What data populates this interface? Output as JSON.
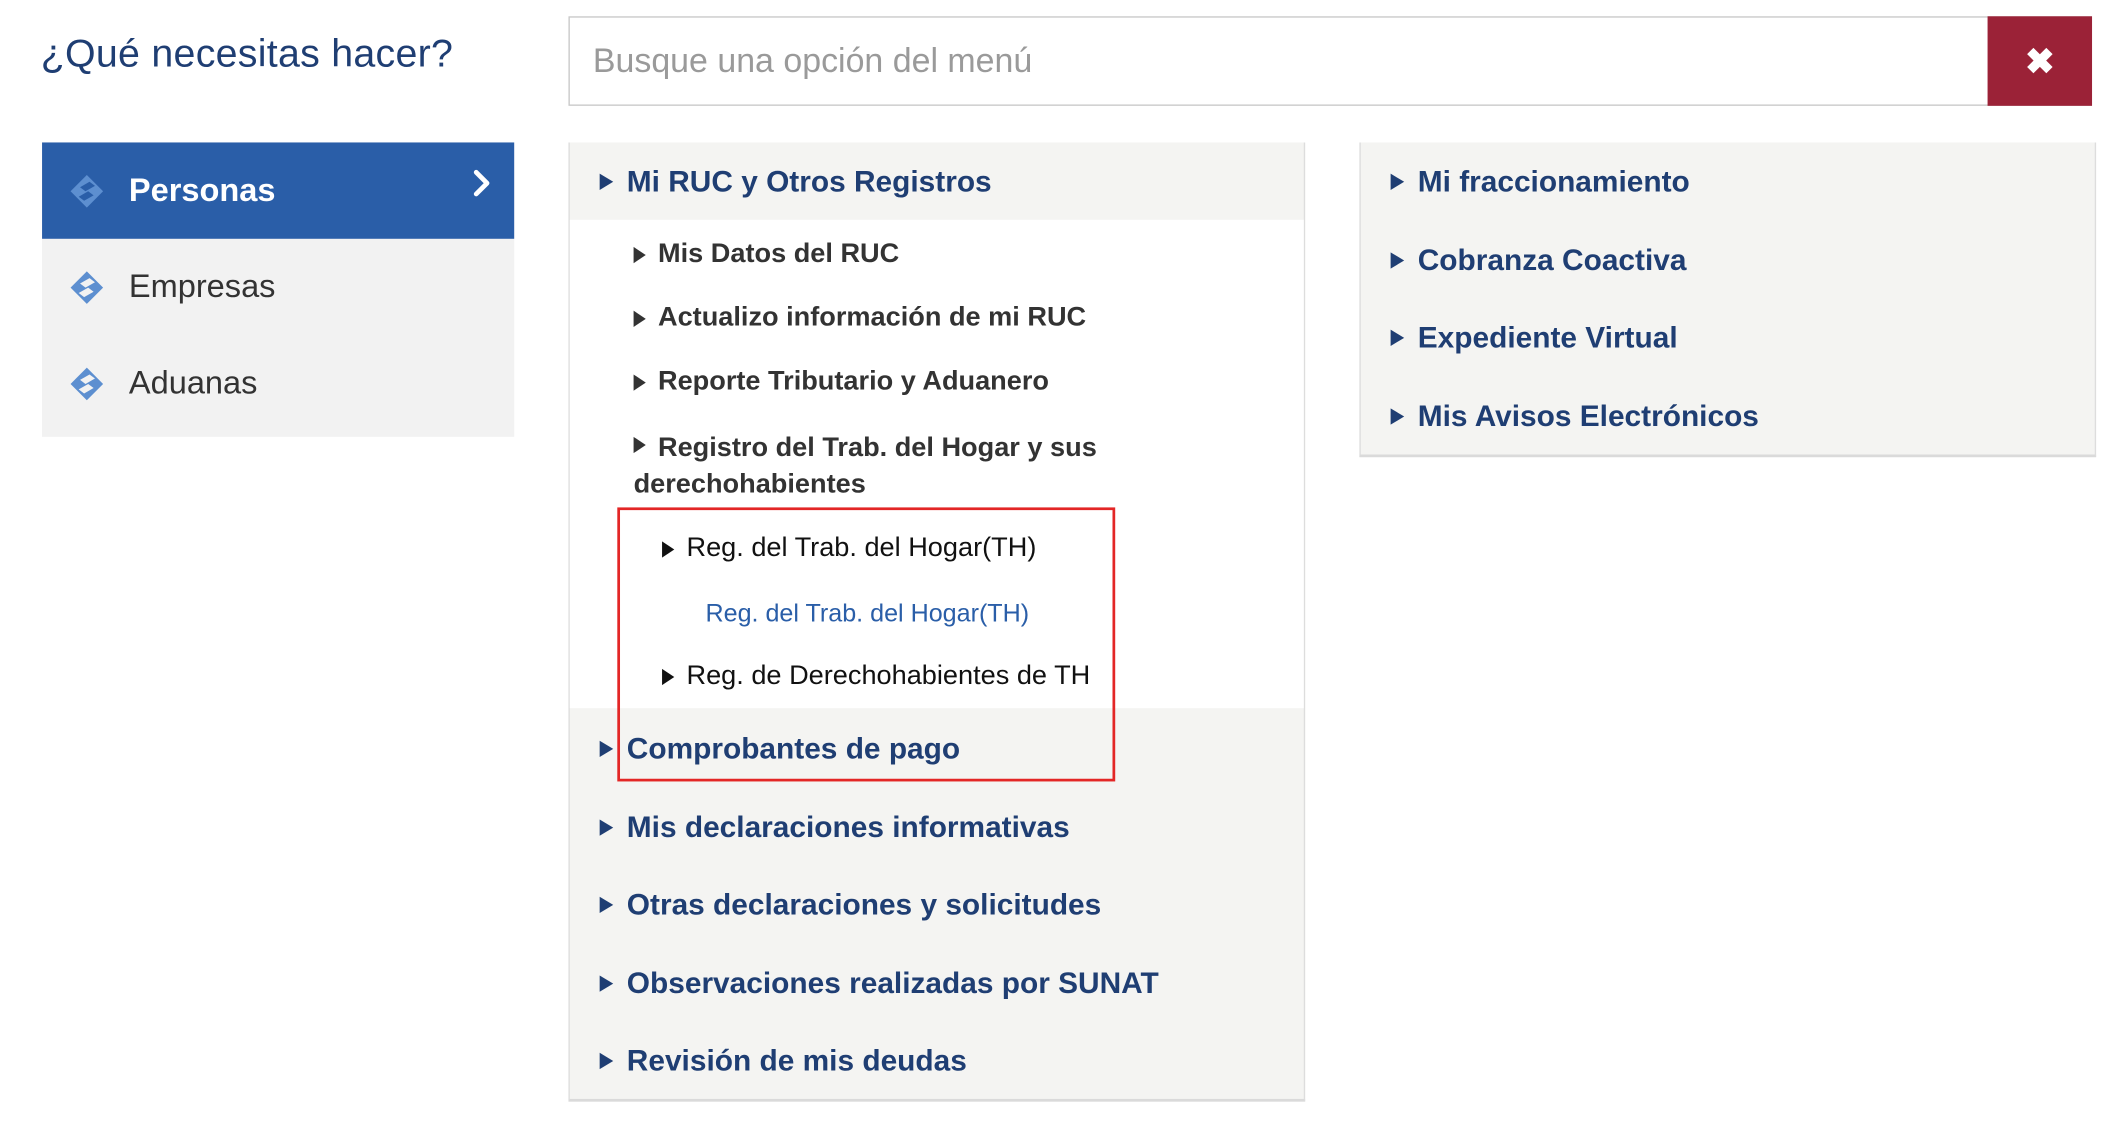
{
  "heading": "¿Qué necesitas hacer?",
  "search": {
    "placeholder": "Busque una opción del menú",
    "value": "",
    "clear_label": "✖"
  },
  "colors": {
    "primary_blue": "#1f3e73",
    "active_blue": "#2a5ea8",
    "clear_red": "#9b2237",
    "highlight_red": "#e32626",
    "panel_bg": "#f4f4f2"
  },
  "sidebar": {
    "items": [
      {
        "label": "Personas",
        "icon": "sunat-logo-icon",
        "active": true
      },
      {
        "label": "Empresas",
        "icon": "sunat-logo-icon",
        "active": false
      },
      {
        "label": "Aduanas",
        "icon": "sunat-logo-icon",
        "active": false
      }
    ]
  },
  "menu_middle": {
    "categories": [
      "Mi RUC y Otros Registros",
      "Comprobantes de pago",
      "Mis declaraciones informativas",
      "Otras declaraciones y solicitudes",
      "Observaciones realizadas por SUNAT",
      "Revisión de mis deudas"
    ],
    "expanded": {
      "items": [
        "Mis Datos del RUC",
        "Actualizo información de mi RUC",
        "Reporte Tributario y Aduanero",
        "Registro del Trab. del Hogar y sus derechohabientes"
      ],
      "nested": {
        "items": [
          "Reg. del Trab. del Hogar(TH)",
          "Reg. de Derechohabientes de TH"
        ],
        "link": "Reg. del Trab. del Hogar(TH)"
      }
    }
  },
  "menu_right": {
    "categories": [
      "Mi fraccionamiento",
      "Cobranza Coactiva",
      "Expediente Virtual",
      "Mis Avisos Electrónicos"
    ]
  }
}
